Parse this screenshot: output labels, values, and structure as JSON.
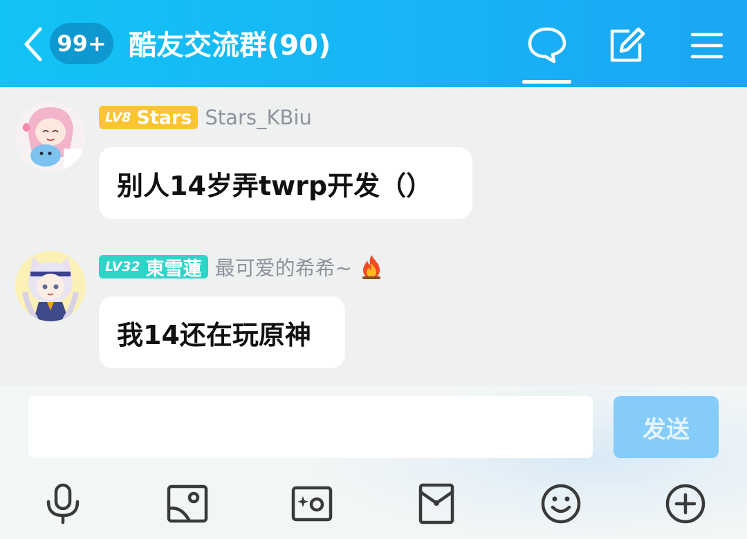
{
  "header": {
    "unread_badge": "99+",
    "group_title": "酷友交流群(90)",
    "icons": [
      "back-arrow-icon",
      "chat-bubble-icon",
      "edit-icon",
      "menu-icon"
    ]
  },
  "messages": [
    {
      "level": "LV8",
      "title": "Stars",
      "badge_color": "#fbc531",
      "nickname": "Stars_KBiu",
      "text": "别人14岁弄twrp开发（）",
      "avatar": "anime-girl-avatar"
    },
    {
      "level": "LV32",
      "title": "東雪蓮",
      "badge_color": "#2fd4c9",
      "nickname": "最可爱的希希~",
      "nickname_icon": "fire-icon",
      "text": "我14还在玩原神",
      "avatar": "anime-catgirl-avatar"
    }
  ],
  "input": {
    "value": "",
    "placeholder": "",
    "send_label": "发送"
  },
  "toolbar": [
    "microphone-icon",
    "image-icon",
    "camera-icon",
    "red-packet-icon",
    "emoji-icon",
    "plus-icon"
  ],
  "colors": {
    "header_accent": "#16b6f6",
    "send_button": "#86ccfa",
    "chat_background": "#eef1f0"
  }
}
